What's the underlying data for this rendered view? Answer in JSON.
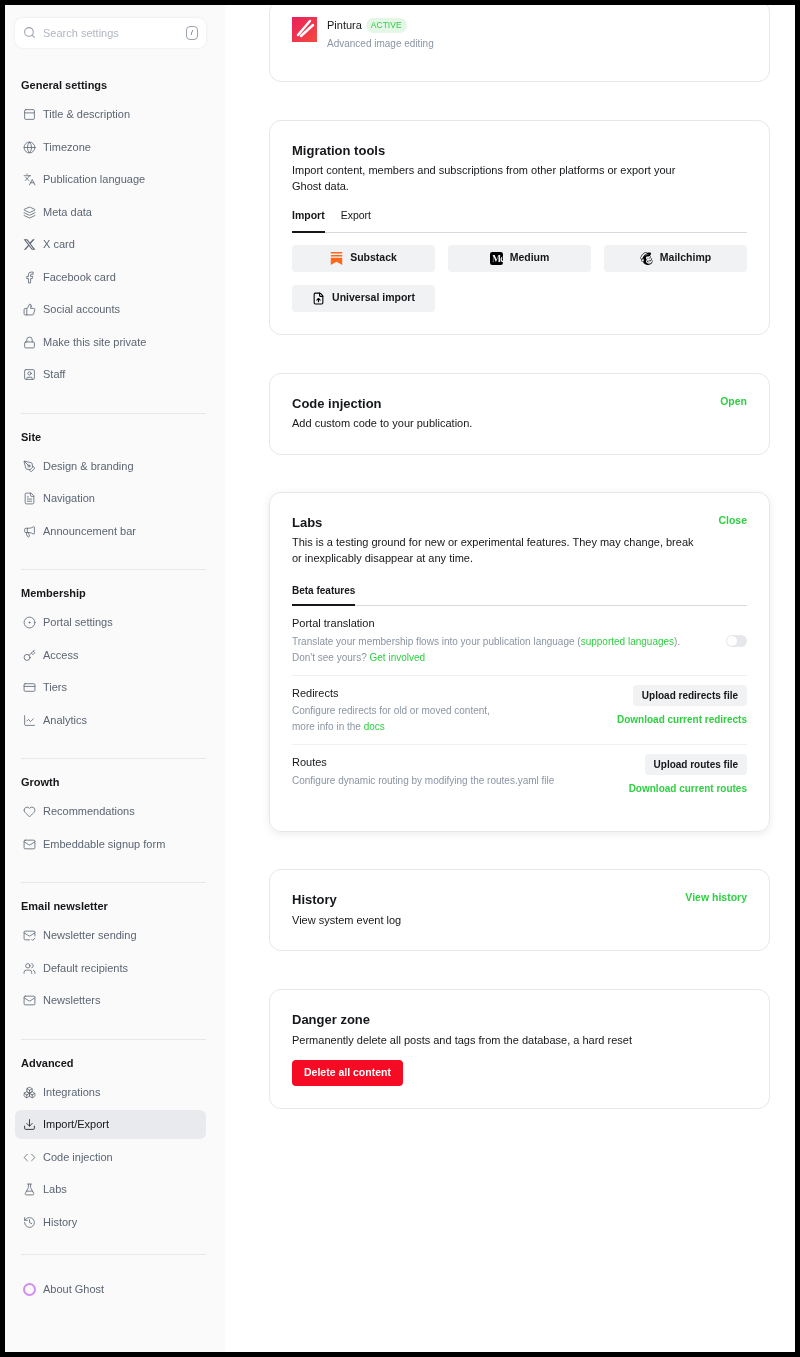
{
  "sidebar": {
    "search": {
      "placeholder": "Search settings",
      "shortcut": "/"
    },
    "groups": [
      {
        "title": "General settings",
        "items": [
          {
            "label": "Title & description",
            "selected": false
          },
          {
            "label": "Timezone",
            "selected": false
          },
          {
            "label": "Publication language",
            "selected": false
          },
          {
            "label": "Meta data",
            "selected": false
          },
          {
            "label": "X card",
            "selected": false
          },
          {
            "label": "Facebook card",
            "selected": false
          },
          {
            "label": "Social accounts",
            "selected": false
          },
          {
            "label": "Make this site private",
            "selected": false
          },
          {
            "label": "Staff",
            "selected": false
          }
        ]
      },
      {
        "title": "Site",
        "items": [
          {
            "label": "Design & branding",
            "selected": false
          },
          {
            "label": "Navigation",
            "selected": false
          },
          {
            "label": "Announcement bar",
            "selected": false
          }
        ]
      },
      {
        "title": "Membership",
        "items": [
          {
            "label": "Portal settings",
            "selected": false
          },
          {
            "label": "Access",
            "selected": false
          },
          {
            "label": "Tiers",
            "selected": false
          },
          {
            "label": "Analytics",
            "selected": false
          }
        ]
      },
      {
        "title": "Growth",
        "items": [
          {
            "label": "Recommendations",
            "selected": false
          },
          {
            "label": "Embeddable signup form",
            "selected": false
          }
        ]
      },
      {
        "title": "Email newsletter",
        "items": [
          {
            "label": "Newsletter sending",
            "selected": false
          },
          {
            "label": "Default recipients",
            "selected": false
          },
          {
            "label": "Newsletters",
            "selected": false
          }
        ]
      },
      {
        "title": "Advanced",
        "items": [
          {
            "label": "Integrations",
            "selected": false
          },
          {
            "label": "Import/Export",
            "selected": true
          },
          {
            "label": "Code injection",
            "selected": false
          },
          {
            "label": "Labs",
            "selected": false
          },
          {
            "label": "History",
            "selected": false
          }
        ]
      }
    ],
    "about": "About Ghost"
  },
  "integration": {
    "name": "Pintura",
    "badge": "ACTIVE",
    "description": "Advanced image editing"
  },
  "migration": {
    "title": "Migration tools",
    "description": "Import content, members and subscriptions from other platforms or export your Ghost data.",
    "tabs": [
      {
        "label": "Import",
        "selected": true
      },
      {
        "label": "Export",
        "selected": false
      }
    ],
    "buttons": [
      {
        "label": "Substack"
      },
      {
        "label": "Medium"
      },
      {
        "label": "Mailchimp"
      },
      {
        "label": "Universal import"
      }
    ]
  },
  "code_injection": {
    "title": "Code injection",
    "description": "Add custom code to your publication.",
    "action": "Open"
  },
  "labs": {
    "title": "Labs",
    "description": "This is a testing ground for new or experimental features. They may change, break or inexplicably disappear at any time.",
    "action": "Close",
    "tabs": [
      {
        "label": "Beta features",
        "selected": true
      }
    ],
    "features": [
      {
        "kind": "toggle",
        "title": "Portal translation",
        "on": false,
        "lines": [
          [
            {
              "text": "Translate your membership flows into your publication language (",
              "link": false
            },
            {
              "text": "supported languages",
              "link": true
            },
            {
              "text": ").",
              "link": false
            }
          ],
          [
            {
              "text": "Don't see yours? ",
              "link": false
            },
            {
              "text": "Get involved",
              "link": true
            }
          ]
        ]
      },
      {
        "kind": "upload",
        "title": "Redirects",
        "button": "Upload redirects file",
        "download": "Download current redirects",
        "lines": [
          [
            {
              "text": "Configure redirects for old or moved content,",
              "link": false
            }
          ],
          [
            {
              "text": "more info in the ",
              "link": false
            },
            {
              "text": "docs",
              "link": true
            }
          ]
        ]
      },
      {
        "kind": "upload",
        "title": "Routes",
        "button": "Upload routes file",
        "download": "Download current routes",
        "lines": [
          [
            {
              "text": "Configure dynamic routing by modifying the routes.yaml file",
              "link": false
            }
          ]
        ]
      }
    ]
  },
  "history": {
    "title": "History",
    "description": "View system event log",
    "action": "View history"
  },
  "danger": {
    "title": "Danger zone",
    "description": "Permanently delete all posts and tags from the database, a hard reset",
    "button": "Delete all content"
  }
}
